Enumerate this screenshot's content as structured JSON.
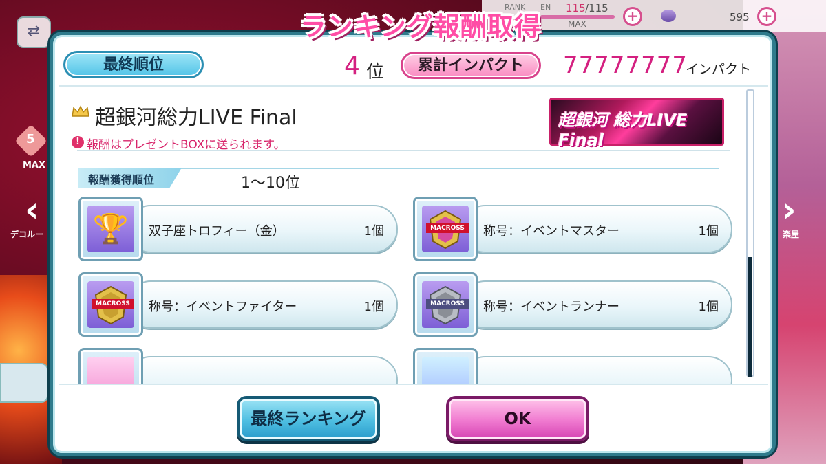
{
  "topbar": {
    "rank_label": "RANK",
    "en_label": "EN",
    "stamina_current": "115",
    "stamina_max": "/115",
    "max_label": "MAX",
    "coins": "595"
  },
  "side": {
    "heart_count": "5",
    "max_label": "MAX",
    "left_label": "デコルー",
    "right_label": "楽屋"
  },
  "dialog": {
    "title": "ランキング報酬取得",
    "final_rank_label": "最終順位",
    "rank_value": "4",
    "rank_unit": "位",
    "total_impact_label": "累計インパクト",
    "impact_value": "77777777",
    "impact_unit": "インパクト",
    "event_name": "超銀河総力LIVE Final",
    "notice": "報酬はプレゼントBOXに送られます。",
    "banner_text": "超銀河 総力LIVE Final",
    "reward_rank_label": "報酬獲得順位",
    "reward_rank_value": "1〜10位",
    "items": [
      {
        "name": "双子座トロフィー（金）",
        "qty": "1個",
        "icon": "trophy-icon"
      },
      {
        "name": "称号：イベントマスター",
        "qty": "1個",
        "icon": "macross-emblem-icon"
      },
      {
        "name": "称号：イベントファイター",
        "qty": "1個",
        "icon": "macross-emblem-icon"
      },
      {
        "name": "称号：イベントランナー",
        "qty": "1個",
        "icon": "macross-emblem-icon"
      }
    ],
    "macross_text": "MACROSS",
    "final_ranking_button": "最終ランキング",
    "ok_button": "OK"
  },
  "colors": {
    "accent_pink": "#ff4da6",
    "accent_blue": "#51c3e7",
    "frame": "#2f7b8c"
  }
}
